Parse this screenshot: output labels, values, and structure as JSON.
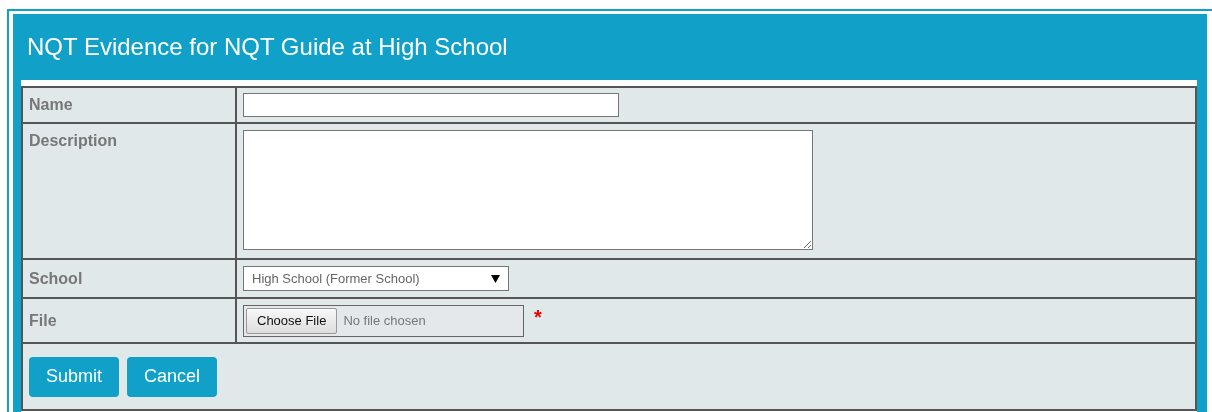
{
  "panel": {
    "title": "NQT Evidence for NQT Guide at High School"
  },
  "fields": [
    {
      "kind": "text",
      "label": "Name",
      "required": false
    },
    {
      "kind": "textarea",
      "label": "Description",
      "required": false
    },
    {
      "kind": "select",
      "label": "School",
      "value": "High School (Former School)",
      "required": false
    },
    {
      "kind": "file",
      "label": "File",
      "button": "Choose File",
      "status": "No file chosen",
      "required": true,
      "required_mark": "*"
    }
  ],
  "buttons": [
    "Submit",
    "Cancel"
  ]
}
